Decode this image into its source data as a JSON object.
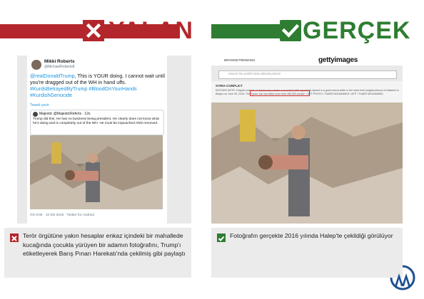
{
  "header": {
    "false_label": "YALAN",
    "true_label": "GERÇEK",
    "false_color": "#b3262b",
    "true_color": "#2e7d32"
  },
  "tweet": {
    "author_name": "Mikki Roberts",
    "author_handle": "@MichaelRoberts8",
    "body_mention": "@realDonaldTrump",
    "body_text": ", This is YOUR doing. I cannot wait until you're dragged out of the WH in hand uffs.",
    "hashtags": "#KurdsBetrayedByTrump #BloodOnYourHands #KurdishGenocide",
    "translate_label": "Tweeti çevir",
    "quote_name": "Majestic @MajesticReferis · 12s",
    "quote_body": "Trump did this. He has no business being president. He clearly does not know what he's doing and is completely out of the WH. He must be impeached AND removed.",
    "footer": "ÖS 9:05 · 10 Eki 2019 · Twitter for Android"
  },
  "getty": {
    "nav_browse": "BROWSE",
    "nav_trending": "TRENDING",
    "logo": "gettyimages",
    "search_placeholder": "Search the world's best editorial photos",
    "caption_title": "SYRIA-CONFLICT",
    "caption_body": "EDITORS NOTE: Graphic content / A Syrian man carries a wounded child reportedly injured in a government strike in the rebel-held neighbourhood of Kallaseh in Aleppo on June 25, 2016. The Syrian war has killed more than 280,000 people. / AFP PHOTO / THAER MOHAMMED / AFP / THAER MOHAMMED"
  },
  "captions": {
    "false_text": "Terör örgütüne yakın hesaplar enkaz içindeki bir mahallede kucağında çocukla yürüyen bir adamın fotoğrafını, Trump'ı etiketleyerek Barış Pınarı Harekatı'nda çekilmiş gibi paylaştı",
    "true_text": "Fotoğrafın gerçekte 2016 yılında Halep'te çekildiği görülüyor"
  }
}
